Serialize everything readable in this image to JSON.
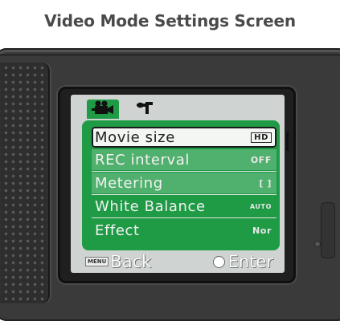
{
  "title": "Video Mode Settings Screen",
  "tabs": [
    {
      "name": "video-camera-icon",
      "active": true
    },
    {
      "name": "setup-wrench-icon",
      "active": false
    }
  ],
  "menu": {
    "items": [
      {
        "label": "Movie size",
        "value": "HD",
        "selected": true
      },
      {
        "label": "REC interval",
        "value": "OFF",
        "selected": false
      },
      {
        "label": "Metering",
        "value": "[ ]",
        "selected": false
      },
      {
        "label": "White Balance",
        "value": "AUTO",
        "selected": false
      },
      {
        "label": "Effect",
        "value": "Nor",
        "selected": false
      }
    ]
  },
  "footer": {
    "menu_badge": "MENU",
    "back_label": "Back",
    "enter_label": "Enter"
  },
  "colors": {
    "accent": "#1f9a45",
    "screen_bg": "#cfd4d2",
    "body": "#3a3a3a"
  }
}
